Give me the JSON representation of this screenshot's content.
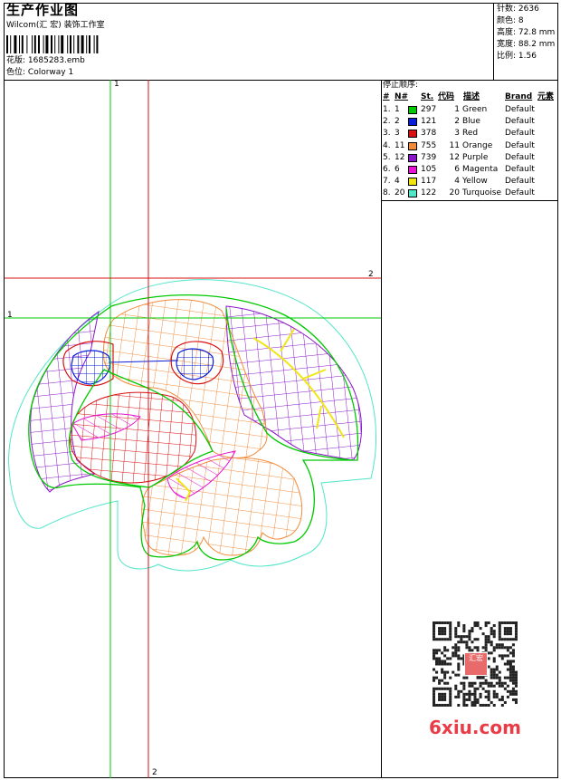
{
  "header": {
    "title": "生产作业图",
    "studio": "Wilcom(汇 宏) 装饰工作室",
    "design_label": "花版:",
    "design_value": "1685283.emb",
    "colorway_label": "色位:",
    "colorway_value": "Colorway 1"
  },
  "stats": {
    "stitches": "针数: 2636",
    "colors": "颜色: 8",
    "height": "高度: 72.8 mm",
    "width": "宽度: 88.2 mm",
    "scale": "比例: 1.56"
  },
  "sequence": {
    "title": "停止顺序:",
    "headers": {
      "num": "#",
      "n": "N#",
      "st": "St.",
      "code": "代码",
      "desc": "描述",
      "brand": "Brand",
      "element": "元素"
    },
    "rows": [
      {
        "num": "1.",
        "n": "1",
        "st": "297",
        "code": "1",
        "desc": "Green",
        "brand": "Default",
        "color": "#00c800"
      },
      {
        "num": "2.",
        "n": "2",
        "st": "121",
        "code": "2",
        "desc": "Blue",
        "brand": "Default",
        "color": "#0a1ed8"
      },
      {
        "num": "3.",
        "n": "3",
        "st": "378",
        "code": "3",
        "desc": "Red",
        "brand": "Default",
        "color": "#d81010"
      },
      {
        "num": "4.",
        "n": "11",
        "st": "755",
        "code": "11",
        "desc": "Orange",
        "brand": "Default",
        "color": "#f08c3c"
      },
      {
        "num": "5.",
        "n": "12",
        "st": "739",
        "code": "12",
        "desc": "Purple",
        "brand": "Default",
        "color": "#8a14c8"
      },
      {
        "num": "6.",
        "n": "6",
        "st": "105",
        "code": "6",
        "desc": "Magenta",
        "brand": "Default",
        "color": "#e614d2"
      },
      {
        "num": "7.",
        "n": "4",
        "st": "117",
        "code": "4",
        "desc": "Yellow",
        "brand": "Default",
        "color": "#f0e614"
      },
      {
        "num": "8.",
        "n": "20",
        "st": "122",
        "code": "20",
        "desc": "Turquoise",
        "brand": "Default",
        "color": "#50e6c8"
      }
    ]
  },
  "guides": {
    "v_green": "1",
    "h_red": "2",
    "h_green": "1",
    "v_red": "2"
  },
  "watermark": {
    "logo": "6xiu.com",
    "stamp": "汇宏"
  },
  "icons": {
    "barcode": "barcode-icon",
    "qr": "qr-code-icon"
  }
}
